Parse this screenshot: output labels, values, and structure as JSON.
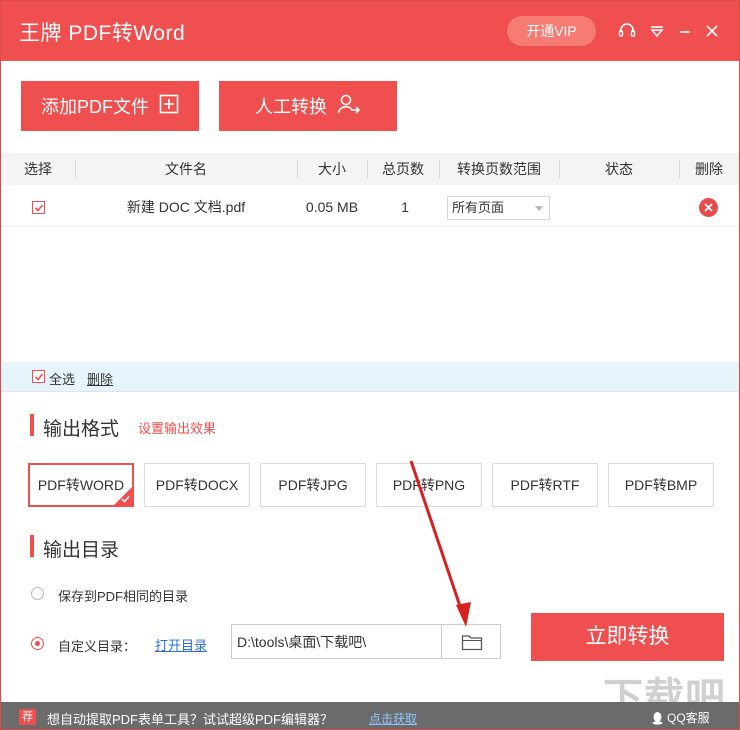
{
  "window": {
    "title": "王牌 PDF转Word",
    "vip_label": "开通VIP"
  },
  "toolbar": {
    "add_pdf_label": "添加PDF文件",
    "manual_convert_label": "人工转换"
  },
  "table": {
    "headers": [
      "选择",
      "文件名",
      "大小",
      "总页数",
      "转换页数范围",
      "状态",
      "删除"
    ],
    "rows": [
      {
        "checked": true,
        "filename": "新建 DOC 文档.pdf",
        "size": "0.05 MB",
        "pages": "1",
        "range": "所有页面",
        "status": ""
      }
    ]
  },
  "selection_bar": {
    "select_all_label": "全选",
    "delete_label": "删除"
  },
  "output_format": {
    "title": "输出格式",
    "settings_link": "设置输出效果",
    "options": [
      "PDF转WORD",
      "PDF转DOCX",
      "PDF转JPG",
      "PDF转PNG",
      "PDF转RTF",
      "PDF转BMP"
    ],
    "selected": "PDF转WORD"
  },
  "output_dir": {
    "title": "输出目录",
    "same_dir_label": "保存到PDF相同的目录",
    "custom_label": "自定义目录：",
    "open_dir_label": "打开目录",
    "path_value": "D:\\tools\\桌面\\下载吧\\",
    "selected": "custom"
  },
  "convert_button": "立即转换",
  "footer": {
    "badge": "荐",
    "ad_text": "想自动提取PDF表单工具？试试超级PDF编辑器？",
    "get_link": "点击获取",
    "qq_label": "QQ客服"
  },
  "watermark": "下载吧",
  "colors": {
    "accent": "#ef4f4f",
    "footer_bg": "#6b6b6b",
    "select_bar_bg": "#e6f4fb",
    "link": "#2b6fd6"
  },
  "icons": [
    "plus-square-icon",
    "user-transfer-icon",
    "headset-icon",
    "dropdown-menu-icon",
    "minimize-icon",
    "close-icon",
    "folder-icon",
    "qq-icon",
    "check-icon"
  ]
}
